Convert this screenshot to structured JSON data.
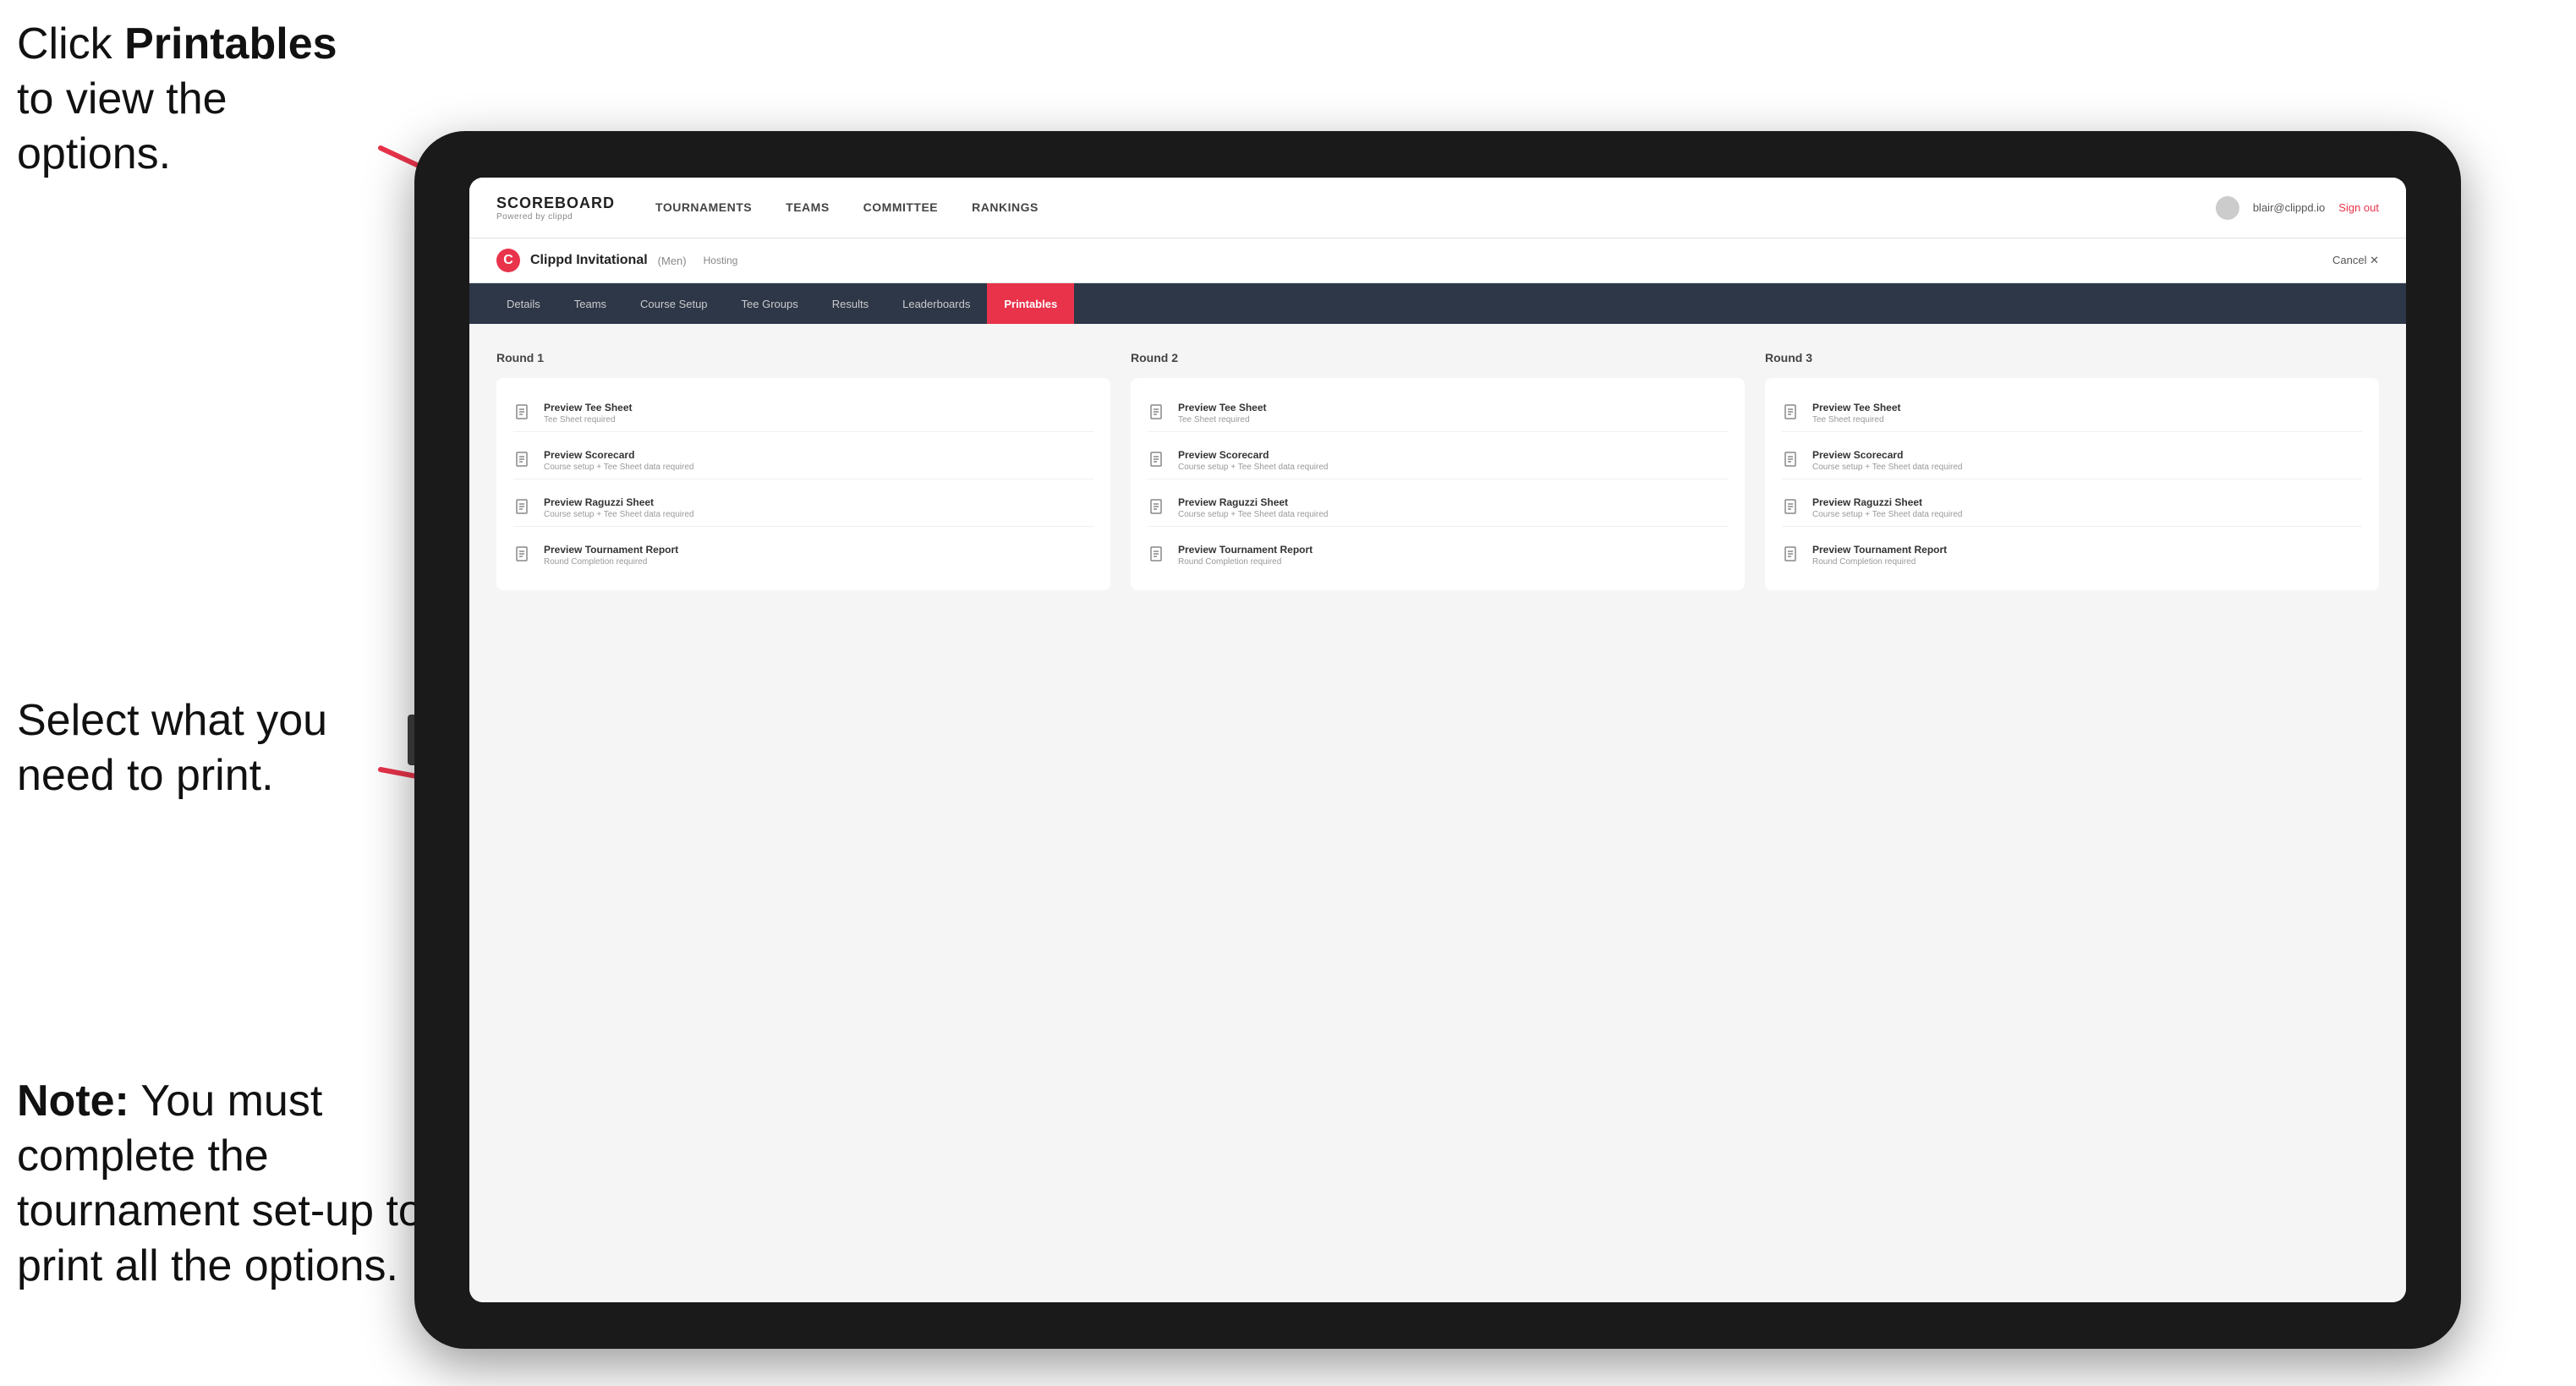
{
  "annotations": {
    "top": {
      "text_normal": "Click ",
      "text_bold": "Printables",
      "text_after": " to view the options."
    },
    "middle": {
      "text": "Select what you need to print."
    },
    "bottom": {
      "text_bold": "Note:",
      "text_after": " You must complete the tournament set-up to print all the options."
    }
  },
  "top_nav": {
    "logo": {
      "title": "SCOREBOARD",
      "subtitle": "Powered by clippd"
    },
    "links": [
      {
        "label": "TOURNAMENTS",
        "active": false
      },
      {
        "label": "TEAMS",
        "active": false
      },
      {
        "label": "COMMITTEE",
        "active": false
      },
      {
        "label": "RANKINGS",
        "active": false
      }
    ],
    "user": {
      "email": "blair@clippd.io",
      "sign_out": "Sign out"
    }
  },
  "sub_header": {
    "tournament": "Clippd Invitational",
    "division": "(Men)",
    "status": "Hosting",
    "cancel": "Cancel ✕"
  },
  "tabs": [
    {
      "label": "Details",
      "active": false
    },
    {
      "label": "Teams",
      "active": false
    },
    {
      "label": "Course Setup",
      "active": false
    },
    {
      "label": "Tee Groups",
      "active": false
    },
    {
      "label": "Results",
      "active": false
    },
    {
      "label": "Leaderboards",
      "active": false
    },
    {
      "label": "Printables",
      "active": true
    }
  ],
  "rounds": [
    {
      "label": "Round 1",
      "items": [
        {
          "title": "Preview Tee Sheet",
          "subtitle": "Tee Sheet required"
        },
        {
          "title": "Preview Scorecard",
          "subtitle": "Course setup + Tee Sheet data required"
        },
        {
          "title": "Preview Raguzzi Sheet",
          "subtitle": "Course setup + Tee Sheet data required"
        },
        {
          "title": "Preview Tournament Report",
          "subtitle": "Round Completion required"
        }
      ]
    },
    {
      "label": "Round 2",
      "items": [
        {
          "title": "Preview Tee Sheet",
          "subtitle": "Tee Sheet required"
        },
        {
          "title": "Preview Scorecard",
          "subtitle": "Course setup + Tee Sheet data required"
        },
        {
          "title": "Preview Raguzzi Sheet",
          "subtitle": "Course setup + Tee Sheet data required"
        },
        {
          "title": "Preview Tournament Report",
          "subtitle": "Round Completion required"
        }
      ]
    },
    {
      "label": "Round 3",
      "items": [
        {
          "title": "Preview Tee Sheet",
          "subtitle": "Tee Sheet required"
        },
        {
          "title": "Preview Scorecard",
          "subtitle": "Course setup + Tee Sheet data required"
        },
        {
          "title": "Preview Raguzzi Sheet",
          "subtitle": "Course setup + Tee Sheet data required"
        },
        {
          "title": "Preview Tournament Report",
          "subtitle": "Round Completion required"
        }
      ]
    }
  ]
}
